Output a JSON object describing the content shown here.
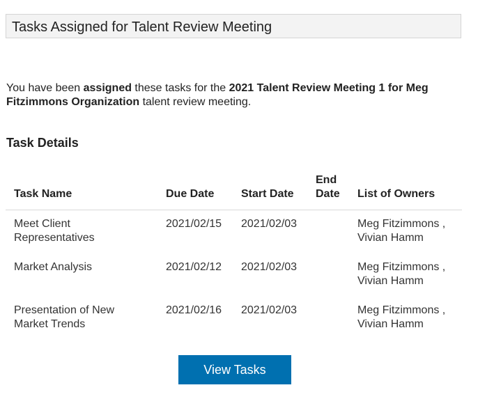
{
  "header": {
    "title": "Tasks Assigned for Talent Review Meeting"
  },
  "intro": {
    "p1": "You have been ",
    "b1": "assigned",
    "p2": " these tasks for the ",
    "b2": "2021 Talent Review Meeting 1 for Meg Fitzimmons Organization",
    "p3": " talent review meeting."
  },
  "section_title": "Task Details",
  "table": {
    "headers": [
      "Task Name",
      "Due Date",
      "Start Date",
      "End Date",
      "List of Owners"
    ],
    "rows": [
      {
        "name": "Meet Client Representatives",
        "due": "2021/02/15",
        "start": "2021/02/03",
        "end": "",
        "owners": "Meg Fitzimmons , Vivian Hamm"
      },
      {
        "name": "Market Analysis",
        "due": "2021/02/12",
        "start": "2021/02/03",
        "end": "",
        "owners": "Meg Fitzimmons , Vivian Hamm"
      },
      {
        "name": "Presentation of New Market Trends",
        "due": "2021/02/16",
        "start": "2021/02/03",
        "end": "",
        "owners": "Meg Fitzimmons , Vivian Hamm"
      }
    ]
  },
  "button": {
    "label": "View Tasks",
    "color": "#0070b0"
  }
}
